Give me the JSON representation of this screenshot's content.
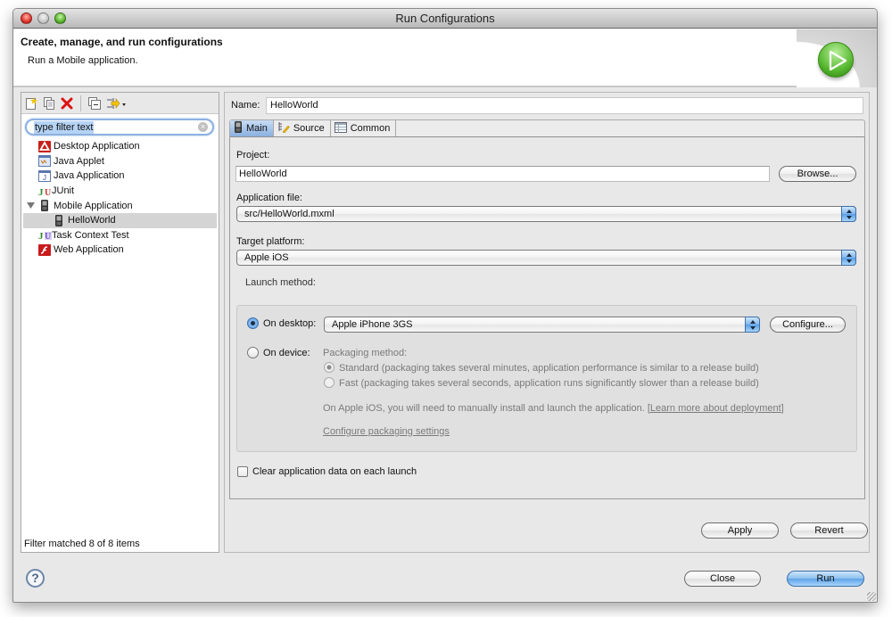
{
  "window": {
    "title": "Run Configurations"
  },
  "header": {
    "title": "Create, manage, and run configurations",
    "subtitle": "Run a Mobile application.",
    "icon": "run-play-icon"
  },
  "left_panel": {
    "toolbar": [
      {
        "name": "new-launch-configuration",
        "icon": "new-config-icon"
      },
      {
        "name": "duplicate-launch-configuration",
        "icon": "duplicate-icon"
      },
      {
        "name": "delete-launch-configuration",
        "icon": "delete-icon"
      },
      {
        "name": "collapse-all",
        "icon": "collapse-all-icon"
      },
      {
        "name": "filter-launch-configurations",
        "icon": "filter-menu-icon"
      }
    ],
    "filter": {
      "placeholder": "type filter text",
      "value": "type filter text"
    },
    "tree": [
      {
        "label": "Desktop Application",
        "icon": "desktop-app-icon",
        "level": 0
      },
      {
        "label": "Java Applet",
        "icon": "java-applet-icon",
        "level": 0
      },
      {
        "label": "Java Application",
        "icon": "java-app-icon",
        "level": 0
      },
      {
        "label": "JUnit",
        "icon": "junit-icon",
        "level": 0
      },
      {
        "label": "Mobile Application",
        "icon": "mobile-app-icon",
        "level": 0,
        "expanded": true
      },
      {
        "label": "HelloWorld",
        "icon": "mobile-device-icon",
        "level": 1,
        "selected": true
      },
      {
        "label": "Task Context Test",
        "icon": "task-context-icon",
        "level": 0
      },
      {
        "label": "Web Application",
        "icon": "flash-web-icon",
        "level": 0
      }
    ],
    "status": "Filter matched 8 of 8 items"
  },
  "right_panel": {
    "name_label": "Name:",
    "name_value": "HelloWorld",
    "tabs": [
      {
        "label": "Main",
        "icon": "mobile-device-icon",
        "active": true
      },
      {
        "label": "Source",
        "icon": "source-icon",
        "active": false
      },
      {
        "label": "Common",
        "icon": "common-icon",
        "active": false
      }
    ],
    "main": {
      "project_label": "Project:",
      "project_value": "HelloWorld",
      "browse_label": "Browse...",
      "app_file_label": "Application file:",
      "app_file_value": "src/HelloWorld.mxml",
      "target_platform_label": "Target platform:",
      "target_platform_value": "Apple iOS",
      "launch_method": {
        "legend": "Launch method:",
        "on_desktop_label": "On desktop:",
        "on_desktop_selected": true,
        "device_value": "Apple iPhone 3GS",
        "configure_label": "Configure...",
        "on_device_label": "On device:",
        "on_device_selected": false,
        "packaging_label": "Packaging method:",
        "standard_label": "Standard (packaging takes several minutes, application performance is similar to a release build)",
        "standard_selected": true,
        "fast_label": "Fast (packaging takes several seconds, application runs significantly slower than a release build)",
        "fast_selected": false,
        "ios_note": "On Apple iOS, you will need to manually install and launch the application.",
        "learn_more_label": "Learn more about deployment",
        "configure_packaging_label": "Configure packaging settings"
      },
      "clear_data_label": "Clear application data on each launch",
      "clear_data_checked": false
    },
    "apply_label": "Apply",
    "revert_label": "Revert"
  },
  "footer": {
    "help_label": "?",
    "close_label": "Close",
    "run_label": "Run"
  }
}
